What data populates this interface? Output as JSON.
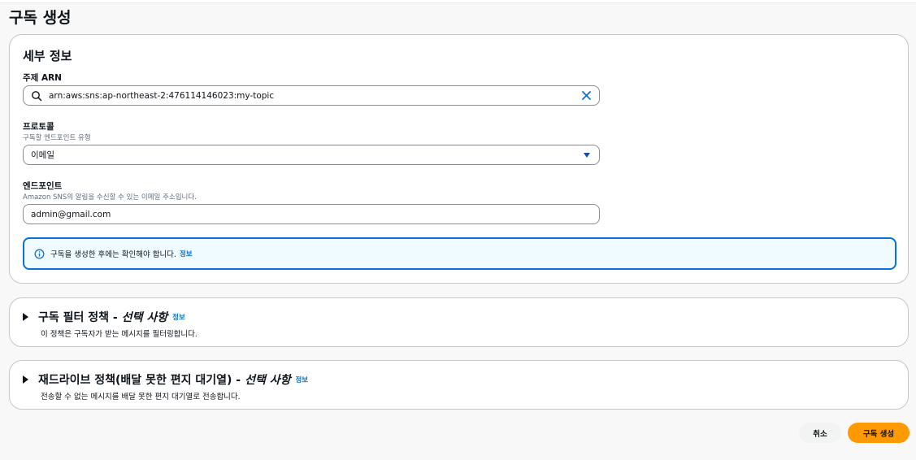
{
  "page": {
    "title": "구독 생성"
  },
  "details": {
    "title": "세부 정보",
    "topic_arn": {
      "label": "주제 ARN",
      "value": "arn:aws:sns:ap-northeast-2:476114146023:my-topic"
    },
    "protocol": {
      "label": "프로토콜",
      "description": "구독할 엔드포인트 유형",
      "selected": "이메일"
    },
    "endpoint": {
      "label": "엔드포인트",
      "description": "Amazon SNS의 알림을 수신할 수 있는 이메일 주소입니다.",
      "value": "admin@gmail.com"
    },
    "alert": {
      "text": "구독을 생성한 후에는 확인해야 합니다.",
      "link": "정보"
    }
  },
  "filter_policy": {
    "title": "구독 필터 정책 -",
    "optional": "선택 사항",
    "info_link": "정보",
    "description": "이 정책은 구독자가 받는 메시지를 필터링합니다."
  },
  "redrive_policy": {
    "title": "재드라이브 정책(배달 못한 편지 대기열) -",
    "optional": "선택 사항",
    "info_link": "정보",
    "description": "전송할 수 없는 메시지를 배달 못한 편지 대기열로 전송합니다."
  },
  "actions": {
    "cancel": "취소",
    "create": "구독 생성"
  },
  "colors": {
    "accent": "#0972d3",
    "primary_button": "#ff9900",
    "info_bg": "#f0fbff"
  },
  "icons": {
    "search": "search-icon",
    "clear": "close-icon",
    "dropdown": "caret-down-icon",
    "info": "info-icon",
    "expand": "caret-right-icon"
  }
}
